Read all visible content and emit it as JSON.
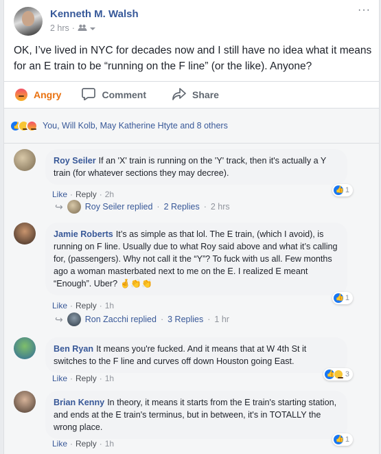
{
  "post": {
    "author": "Kenneth M. Walsh",
    "time": "2 hrs",
    "privacy_icon": "friends-icon",
    "text": "OK, I’ve lived in NYC for decades now and I still have no idea what it means for an E train to be “running on the F line” (or the like). Anyone?"
  },
  "actions": {
    "angry_label": "Angry",
    "comment_label": "Comment",
    "share_label": "Share"
  },
  "reactions": {
    "summary": "You, Will Kolb, May Katherine Htyte and 8 others"
  },
  "comments": [
    {
      "name": "Roy Seiler",
      "text": "If an 'X' train is running on the 'Y' track, then it's actually a Y train (for whatever sections they may decree).",
      "like": "Like",
      "reply": "Reply",
      "time": "2h",
      "reaction_count": "1",
      "replies": {
        "who": "Roy Seiler replied",
        "count": "2 Replies",
        "time": "2 hrs"
      }
    },
    {
      "name": "Jamie Roberts",
      "text": "It’s as simple as that lol. The E train, (which I avoid), is running on F line. Usually due to what Roy said above and what it’s calling for, (passengers). Why not call it the “Y”? To fuck with us all. Few months ago a woman masterbated next to me on the E. I realized E meant “Enough”. Uber?",
      "emoji_tail": "🤞👏👏",
      "like": "Like",
      "reply": "Reply",
      "time": "1h",
      "reaction_count": "1",
      "replies": {
        "who": "Ron Zacchi replied",
        "count": "3 Replies",
        "time": "1 hr"
      }
    },
    {
      "name": "Ben Ryan",
      "text": "It means you're fucked. And it means that at W 4th St it switches to the F line and curves off down Houston going East.",
      "like": "Like",
      "reply": "Reply",
      "time": "1h",
      "reaction_count": "3"
    },
    {
      "name": "Brian Kenny",
      "text": "In theory, it means it starts from the E train's starting station, and ends at the E train's terminus, but in between, it's in TOTALLY the wrong place.",
      "like": "Like",
      "reply": "Reply",
      "time": "1h",
      "reaction_count": "1"
    }
  ],
  "colors": {
    "link_blue": "#385898",
    "angry_orange": "#e9710f",
    "meta_gray": "#90949c"
  }
}
